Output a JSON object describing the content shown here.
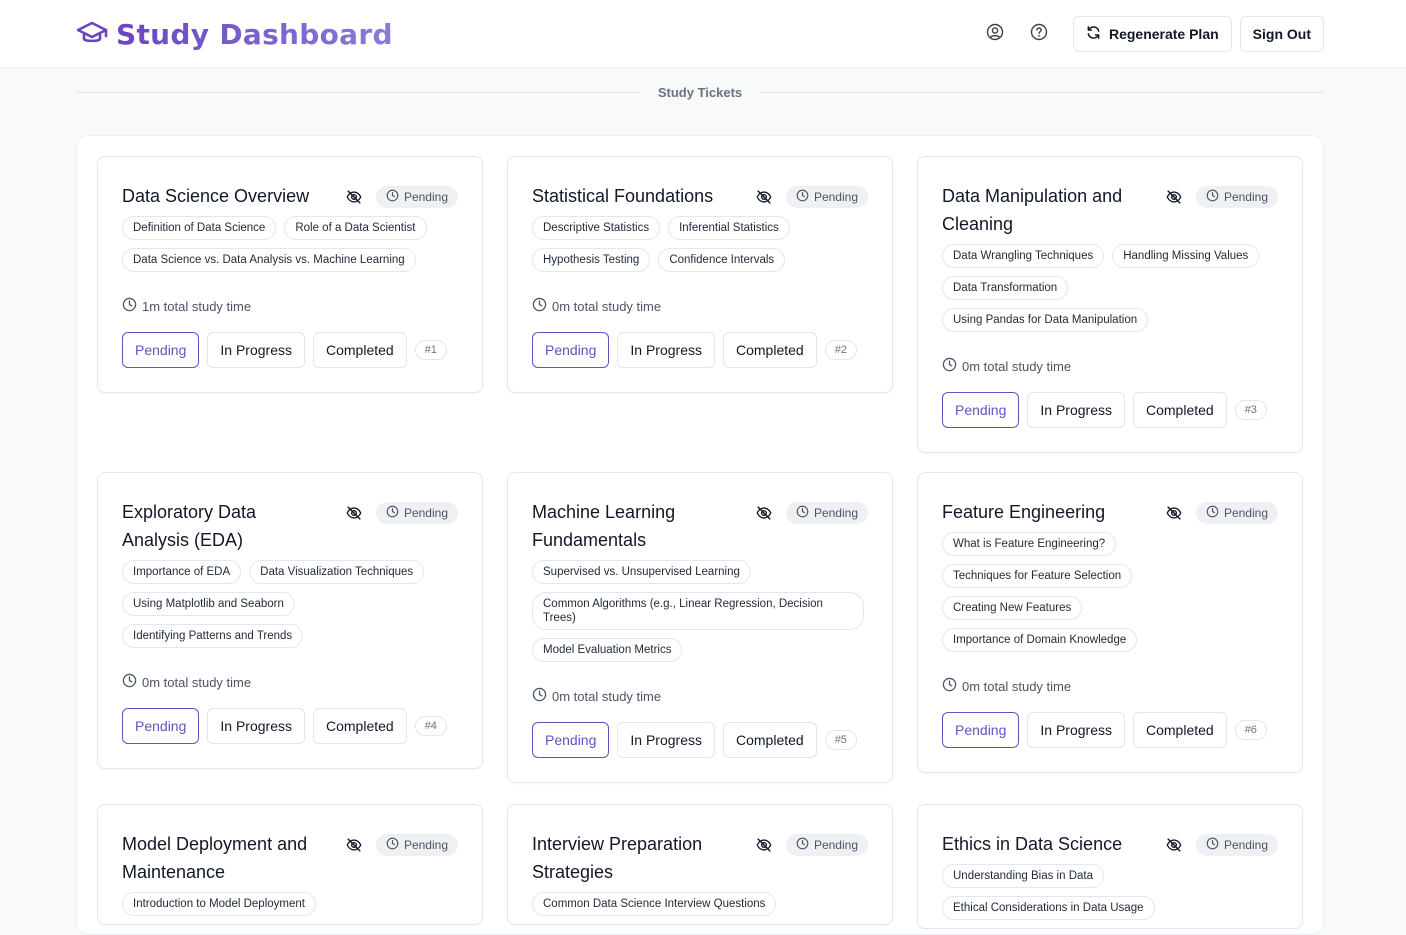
{
  "app": {
    "title": "Study Dashboard",
    "accent": "#6a4fc1"
  },
  "header": {
    "regenerate_label": "Regenerate Plan",
    "sign_out_label": "Sign Out"
  },
  "section": {
    "label": "Study Tickets"
  },
  "tickets": [
    {
      "title": "Data Science Overview",
      "status": "Pending",
      "topics": [
        "Definition of Data Science",
        "Role of a Data Scientist",
        "Data Science vs. Data Analysis vs. Machine Learning"
      ],
      "time": "1m total study time",
      "actions": [
        "Pending",
        "In Progress",
        "Completed"
      ],
      "number": "#1"
    },
    {
      "title": "Statistical Foundations",
      "status": "Pending",
      "topics": [
        "Descriptive Statistics",
        "Inferential Statistics",
        "Hypothesis Testing",
        "Confidence Intervals"
      ],
      "time": "0m total study time",
      "actions": [
        "Pending",
        "In Progress",
        "Completed"
      ],
      "number": "#2"
    },
    {
      "title": "Data Manipulation and Cleaning",
      "status": "Pending",
      "topics": [
        "Data Wrangling Techniques",
        "Handling Missing Values",
        "Data Transformation",
        "Using Pandas for Data Manipulation"
      ],
      "time": "0m total study time",
      "actions": [
        "Pending",
        "In Progress",
        "Completed"
      ],
      "number": "#3"
    },
    {
      "title": "Exploratory Data Analysis (EDA)",
      "status": "Pending",
      "topics": [
        "Importance of EDA",
        "Data Visualization Techniques",
        "Using Matplotlib and Seaborn",
        "Identifying Patterns and Trends"
      ],
      "time": "0m total study time",
      "actions": [
        "Pending",
        "In Progress",
        "Completed"
      ],
      "number": "#4"
    },
    {
      "title": "Machine Learning Fundamentals",
      "status": "Pending",
      "topics": [
        "Supervised vs. Unsupervised Learning",
        "Common Algorithms (e.g., Linear Regression, Decision Trees)",
        "Model Evaluation Metrics"
      ],
      "time": "0m total study time",
      "actions": [
        "Pending",
        "In Progress",
        "Completed"
      ],
      "number": "#5"
    },
    {
      "title": "Feature Engineering",
      "status": "Pending",
      "topics": [
        "What is Feature Engineering?",
        "Techniques for Feature Selection",
        "Creating New Features",
        "Importance of Domain Knowledge"
      ],
      "time": "0m total study time",
      "actions": [
        "Pending",
        "In Progress",
        "Completed"
      ],
      "number": "#6"
    },
    {
      "title": "Model Deployment and Maintenance",
      "status": "Pending",
      "topics": [
        "Introduction to Model Deployment"
      ],
      "time": "",
      "actions": [],
      "number": ""
    },
    {
      "title": "Interview Preparation Strategies",
      "status": "Pending",
      "topics": [
        "Common Data Science Interview Questions"
      ],
      "time": "",
      "actions": [],
      "number": ""
    },
    {
      "title": "Ethics in Data Science",
      "status": "Pending",
      "topics": [
        "Understanding Bias in Data",
        "Ethical Considerations in Data Usage"
      ],
      "time": "",
      "actions": [],
      "number": ""
    }
  ]
}
